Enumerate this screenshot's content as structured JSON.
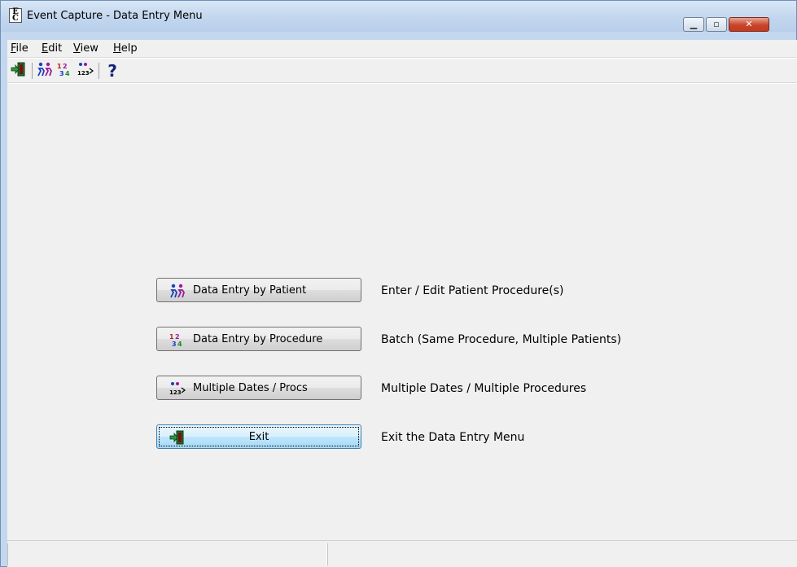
{
  "window": {
    "title": "Event Capture - Data Entry Menu",
    "app_icon_letters": [
      "E",
      "C"
    ]
  },
  "menubar": {
    "items": [
      "File",
      "Edit",
      "View",
      "Help"
    ]
  },
  "toolbar": {
    "buttons": [
      "exit-icon",
      "patients-icon",
      "numbers-icon",
      "multiple-dates-icon",
      "help-icon"
    ],
    "help_glyph": "?"
  },
  "actions": [
    {
      "label": "Data Entry by Patient",
      "description": "Enter / Edit Patient Procedure(s)",
      "icon": "patients-icon"
    },
    {
      "label": "Data Entry by Procedure",
      "description": "Batch (Same Procedure, Multiple Patients)",
      "icon": "numbers-icon"
    },
    {
      "label": "Multiple Dates / Procs",
      "description": "Multiple Dates / Multiple Procedures",
      "icon": "multiple-dates-icon"
    },
    {
      "label": "Exit",
      "description": "Exit the Data Entry Menu",
      "icon": "exit-icon"
    }
  ],
  "colors": {
    "title_bar": "#c2d6ee",
    "client_bg": "#f0f0f0",
    "close_button": "#c9442a",
    "focused_button": "#bee6fd"
  }
}
